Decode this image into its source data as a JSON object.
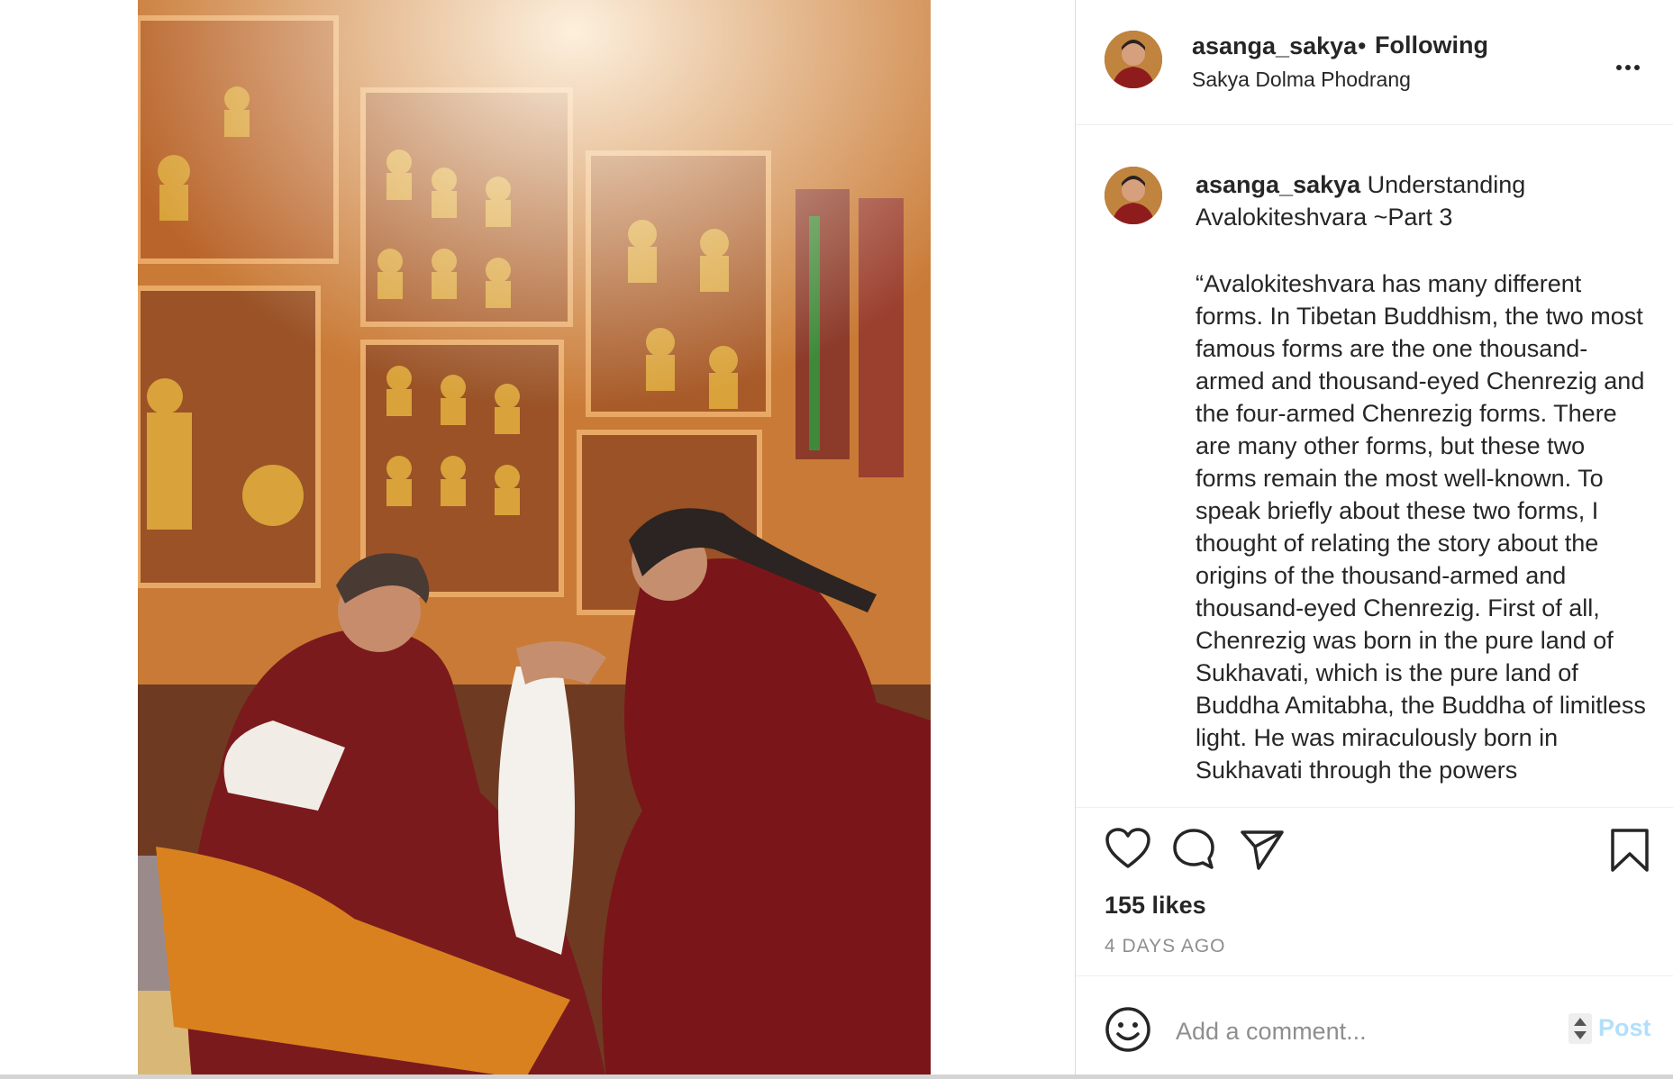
{
  "post": {
    "photo_icon": "photo-image",
    "header": {
      "username": "asanga_sakya",
      "separator": "•",
      "follow_status": "Following",
      "location": "Sakya Dolma Phodrang",
      "more_icon": "more-horizontal-icon"
    },
    "caption": {
      "username": "asanga_sakya",
      "title": " Understanding Avalokiteshvara ~Part 3",
      "body": "“Avalokiteshvara has many different forms. In Tibetan Buddhism, the two most famous forms are the one thousand-armed and thousand-eyed Chenrezig and the four-armed Chenrezig forms. There are many other forms, but these two forms remain the most well-known. To speak briefly about these two forms, I thought of relating the story about the origins of the thousand-armed and thousand-eyed Chenrezig. First of all, Chenrezig was born in the pure land of Sukhavati, which is the pure land of Buddha Amitabha, the Buddha of limitless light. He was miraculously born in Sukhavati through the powers"
    },
    "actions": {
      "like_icon": "heart-icon",
      "comment_icon": "comment-icon",
      "share_icon": "paper-plane-icon",
      "save_icon": "bookmark-icon"
    },
    "likes": "155 likes",
    "timestamp": "4 DAYS AGO",
    "comment": {
      "emoji_icon": "emoji-icon",
      "placeholder": "Add a comment...",
      "post_label": "Post"
    },
    "colors": {
      "text": "#262626",
      "muted": "#8e8e8e",
      "post_disabled": "#b2dffc",
      "divider": "#efefef"
    }
  }
}
